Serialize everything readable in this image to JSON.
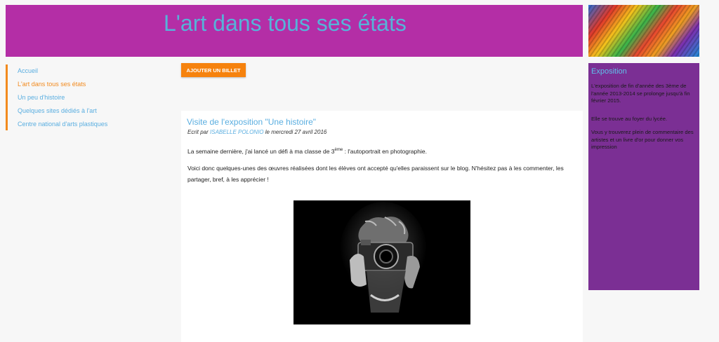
{
  "header": {
    "title": "L'art dans tous ses états",
    "banner_image": "colorful-abstract-painting"
  },
  "nav": {
    "items": [
      {
        "label": "Accueil"
      },
      {
        "label": "L'art dans tous ses états",
        "active": true
      },
      {
        "label": "Un peu d'histoire"
      },
      {
        "label": "Quelques sites dédiés à l'art"
      },
      {
        "label": "Centre national d'arts plastiques"
      }
    ]
  },
  "toolbar": {
    "add_post_label": "AJOUTER UN BILLET"
  },
  "post": {
    "title": "Visite de l'exposition \"Une histoire\"",
    "meta_prefix": "Ecrit par",
    "author": "ISABELLE POLONIO",
    "meta_suffix": "le mercredi 27 avril 2016",
    "p1_before": "La semaine dernière, j'ai lancé un défi à ma classe de 3",
    "p1_sup": "ème",
    "p1_after": " : l'autoportrait en photographie.",
    "p2": "Voici donc quelques-unes des œuvres réalisées dont les élèves ont accepté qu'elles paraissent sur le blog. N'hésitez pas à les commenter, les partager, bref, à les apprécier !",
    "image": "self-portrait-with-camera"
  },
  "sidebar": {
    "title": "Exposition",
    "paragraphs": [
      "L'exposition de fin d'année des 3ème de l'année 2013-2014 se prolonge jusqu'à fin février 2015.",
      "Elle se trouve au foyer du lycée.",
      "Vous y trouverez plein de commentaire des artistes et un livre d'or pour donner vos impression"
    ]
  },
  "colors": {
    "header_bg": "#b42ea6",
    "title": "#56b3d9",
    "link": "#5aaee0",
    "accent": "#f6820d",
    "sidebar_bg": "#7b2f94"
  }
}
